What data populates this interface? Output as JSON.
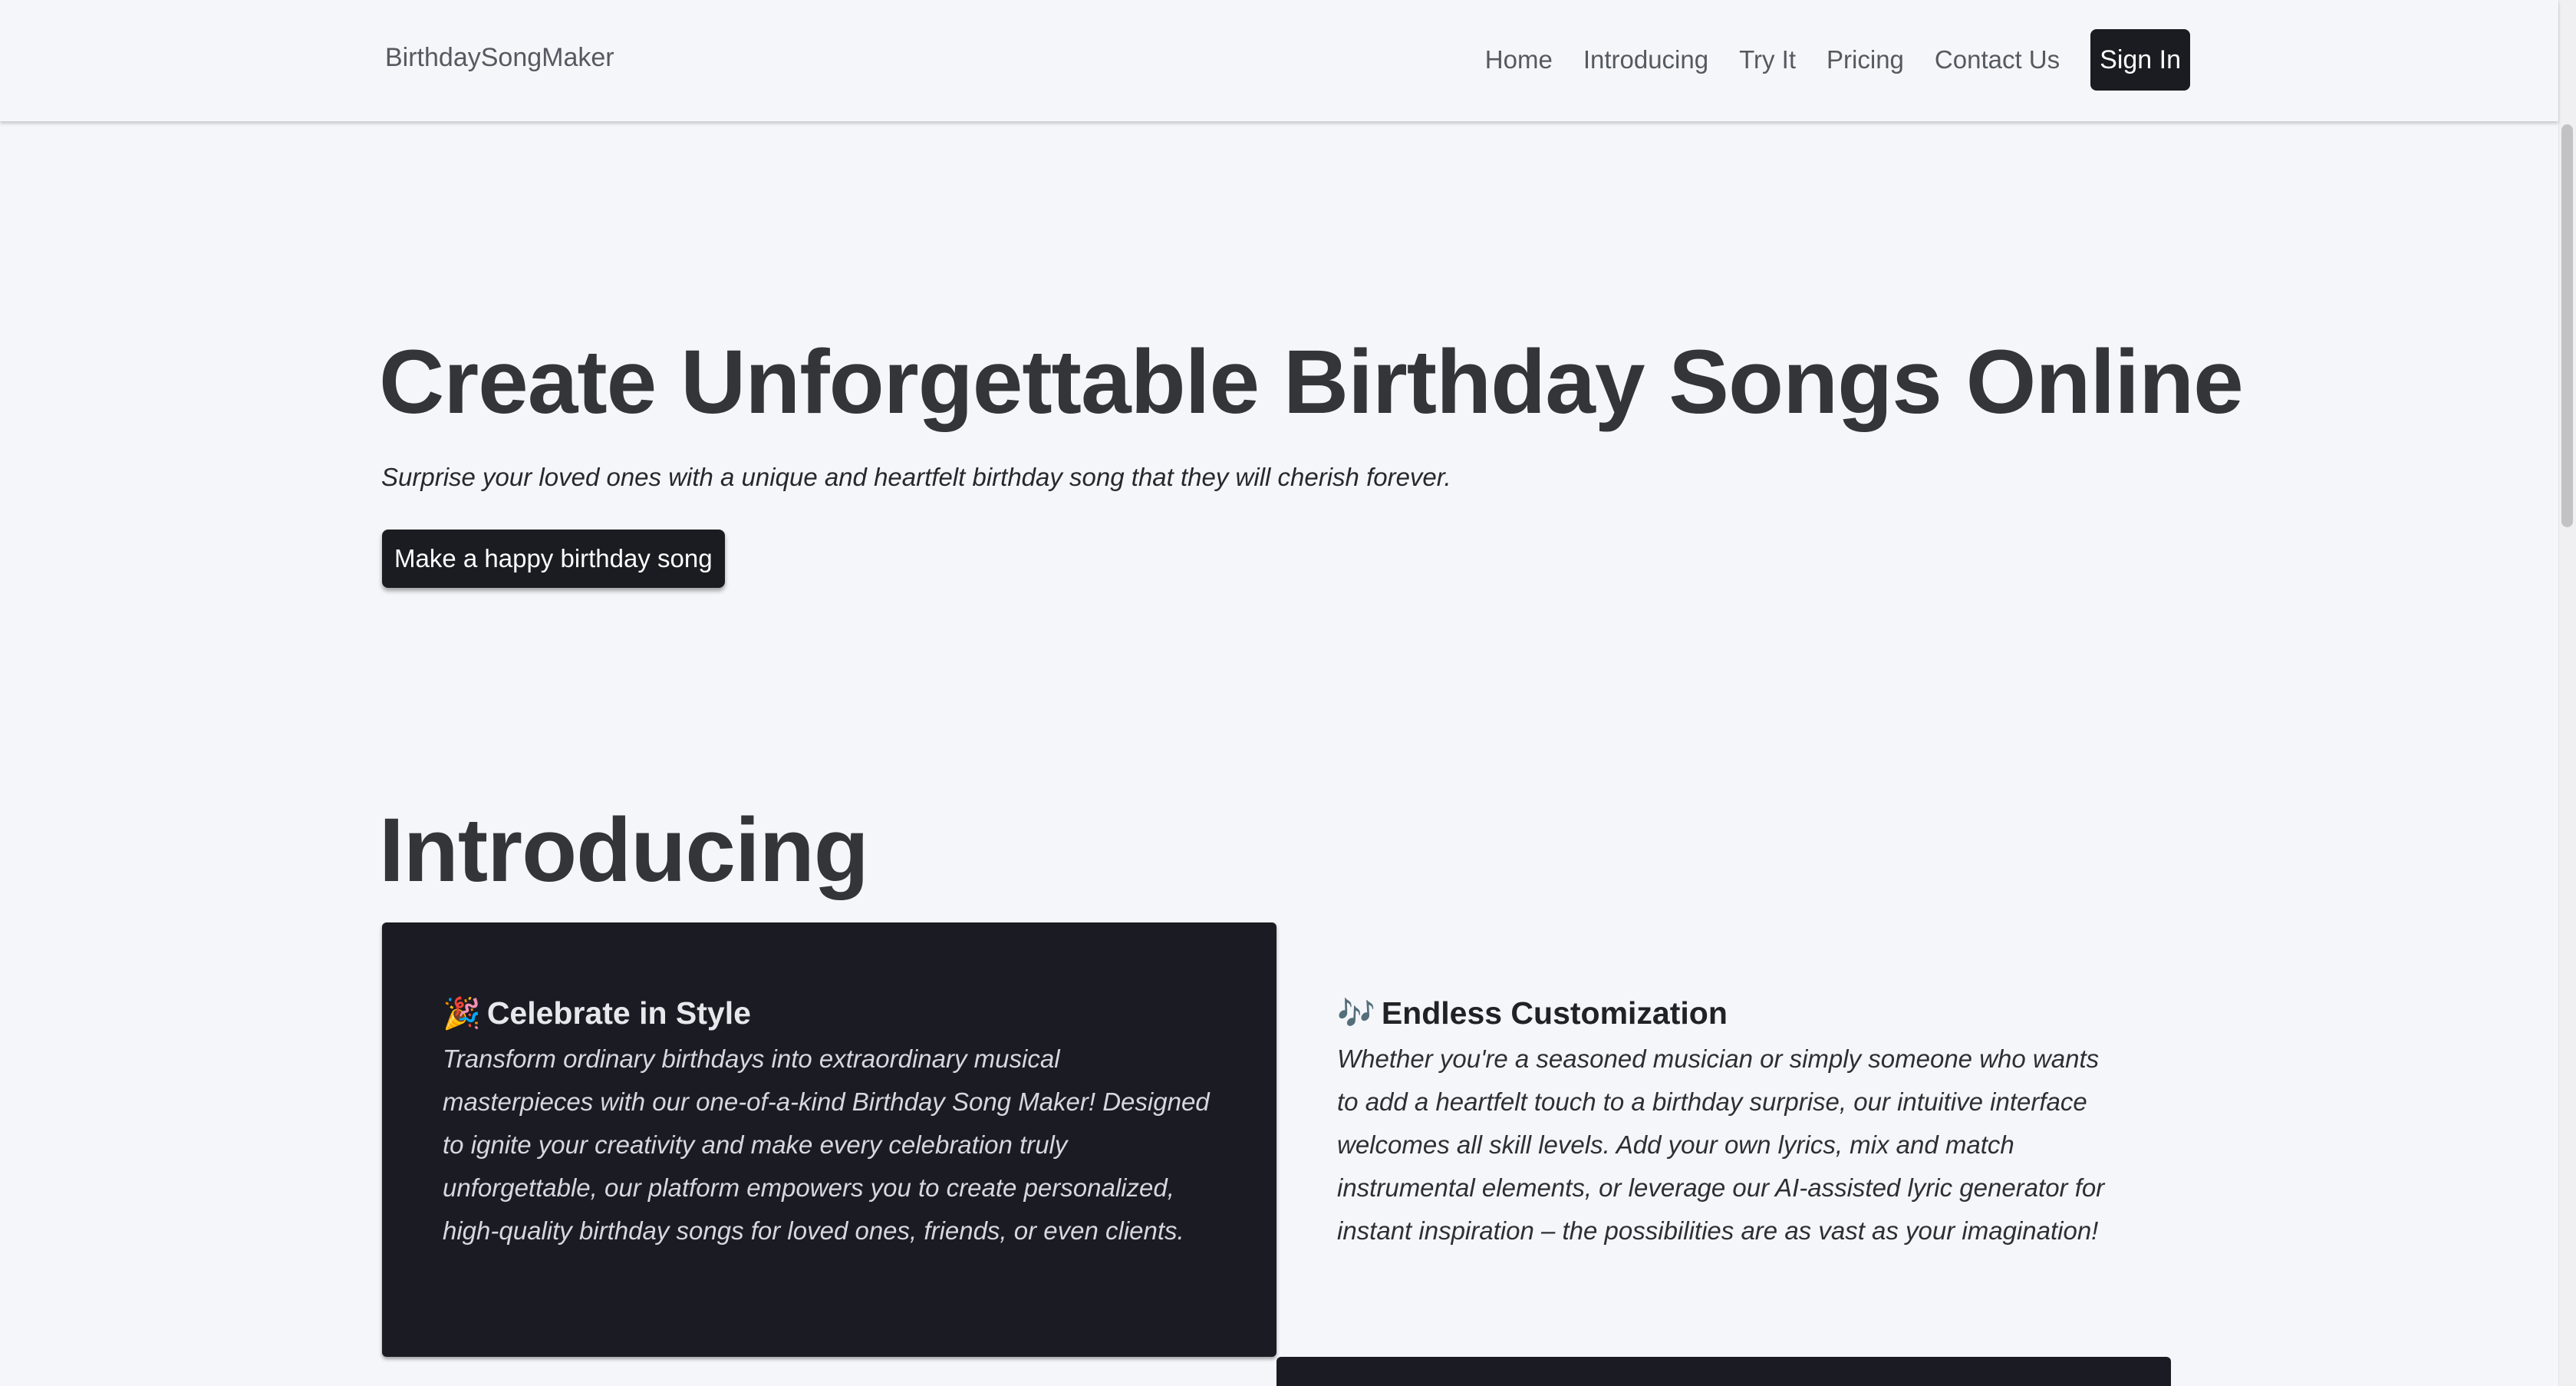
{
  "nav": {
    "brand": "BirthdaySongMaker",
    "links": [
      "Home",
      "Introducing",
      "Try It",
      "Pricing",
      "Contact Us"
    ],
    "signin_label": "Sign In"
  },
  "hero": {
    "title": "Create Unforgettable Birthday Songs Online",
    "subtitle": "Surprise your loved ones with a unique and heartfelt birthday song that they will cherish forever.",
    "cta_label": "Make a happy birthday song"
  },
  "introducing": {
    "title": "Introducing",
    "cards": [
      {
        "icon": "🎉",
        "icon_name": "party-popper-icon",
        "title": "Celebrate in Style",
        "text": "Transform ordinary birthdays into extraordinary musical masterpieces with our one-of-a-kind Birthday Song Maker! Designed to ignite your creativity and make every celebration truly unforgettable, our platform empowers you to create personalized, high-quality birthday songs for loved ones, friends, or even clients."
      },
      {
        "icon": "🎶",
        "icon_name": "musical-notes-icon",
        "title": "Endless Customization",
        "text": "Whether you're a seasoned musician or simply someone who wants to add a heartfelt touch to a birthday surprise, our intuitive interface welcomes all skill levels. Add your own lyrics, mix and match instrumental elements, or leverage our AI-assisted lyric generator for instant inspiration – the possibilities are as vast as your imagination!"
      }
    ]
  },
  "colors": {
    "background": "#f5f6fa",
    "dark": "#1b1b23",
    "button": "#1b1c21",
    "text": "#333538"
  }
}
